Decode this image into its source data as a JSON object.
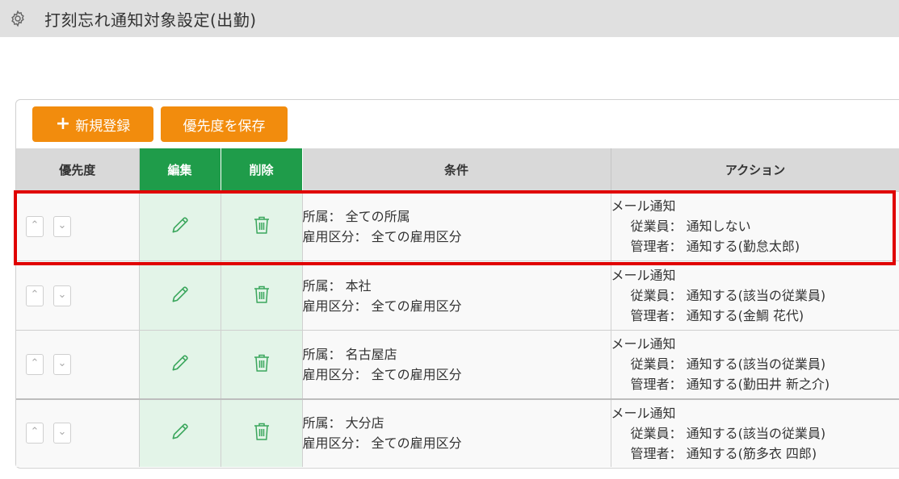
{
  "header": {
    "title": "打刻忘れ通知対象設定(出勤)",
    "icon": "gear-icon"
  },
  "toolbar": {
    "add_label": "新規登録",
    "save_priority_label": "優先度を保存"
  },
  "table": {
    "columns": [
      "優先度",
      "編集",
      "削除",
      "条件",
      "アクション"
    ],
    "rows": [
      {
        "condition_line1": "所属： 全ての所属",
        "condition_line2": "雇用区分： 全ての雇用区分",
        "action_title": "メール通知",
        "action_employee": "従業員： 通知しない",
        "action_manager": "管理者： 通知する(勤怠太郎)"
      },
      {
        "condition_line1": "所属： 本社",
        "condition_line2": "雇用区分： 全ての雇用区分",
        "action_title": "メール通知",
        "action_employee": "従業員： 通知する(該当の従業員)",
        "action_manager": "管理者： 通知する(金鯛 花代)"
      },
      {
        "condition_line1": "所属： 名古屋店",
        "condition_line2": "雇用区分： 全ての雇用区分",
        "action_title": "メール通知",
        "action_employee": "従業員： 通知する(該当の従業員)",
        "action_manager": "管理者： 通知する(勤田井 新之介)"
      },
      {
        "condition_line1": "所属： 大分店",
        "condition_line2": "雇用区分： 全ての雇用区分",
        "action_title": "メール通知",
        "action_employee": "従業員： 通知する(該当の従業員)",
        "action_manager": "管理者： 通知する(筋多衣 四郎)"
      }
    ]
  },
  "colors": {
    "accent": "#f28c0d",
    "header_green": "#1f9c4a",
    "highlight": "#e00000"
  }
}
